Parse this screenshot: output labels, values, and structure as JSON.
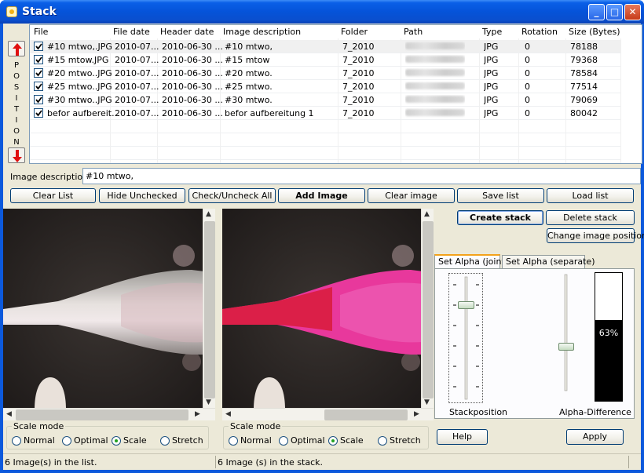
{
  "window": {
    "title": "Stack",
    "minimize_label": "_",
    "maximize_label": "□",
    "close_label": "✕"
  },
  "position_letters": [
    "P",
    "O",
    "S",
    "I",
    "T",
    "I",
    "O",
    "N"
  ],
  "list": {
    "columns": [
      "File",
      "File date",
      "Header date",
      "Image description",
      "Folder",
      "Path",
      "Type",
      "Rotation",
      "Size (Bytes)"
    ],
    "rows": [
      {
        "file": "#10 mtwo,.JPG",
        "file_date": "2010-07...",
        "header_date": "2010-06-30 ...",
        "description": "#10 mtwo,",
        "folder": "7_2010",
        "type": "JPG",
        "rotation": "0",
        "size": "78188",
        "checked": true
      },
      {
        "file": "#15 mtow.JPG",
        "file_date": "2010-07...",
        "header_date": "2010-06-30 ...",
        "description": "#15 mtow",
        "folder": "7_2010",
        "type": "JPG",
        "rotation": "0",
        "size": "79368",
        "checked": true
      },
      {
        "file": "#20 mtwo..JPG",
        "file_date": "2010-07...",
        "header_date": "2010-06-30 ...",
        "description": "#20 mtwo.",
        "folder": "7_2010",
        "type": "JPG",
        "rotation": "0",
        "size": "78584",
        "checked": true
      },
      {
        "file": "#25 mtwo..JPG",
        "file_date": "2010-07...",
        "header_date": "2010-06-30 ...",
        "description": "#25 mtwo.",
        "folder": "7_2010",
        "type": "JPG",
        "rotation": "0",
        "size": "77514",
        "checked": true
      },
      {
        "file": "#30 mtwo..JPG",
        "file_date": "2010-07...",
        "header_date": "2010-06-30 ...",
        "description": "#30 mtwo.",
        "folder": "7_2010",
        "type": "JPG",
        "rotation": "0",
        "size": "79069",
        "checked": true
      },
      {
        "file": "befor aufbereit...",
        "file_date": "2010-07...",
        "header_date": "2010-06-30 ...",
        "description": "befor aufbereitung 1",
        "folder": "7_2010",
        "type": "JPG",
        "rotation": "0",
        "size": "80042",
        "checked": true
      }
    ]
  },
  "description": {
    "label": "Image description",
    "value": "#10 mtwo,"
  },
  "buttons": {
    "clear_list": "Clear List",
    "hide_unchecked": "Hide Unchecked",
    "check_uncheck_all": "Check/Uncheck All",
    "add_image": "Add Image",
    "clear_image": "Clear image",
    "save_list": "Save list",
    "load_list": "Load list",
    "create_stack": "Create stack",
    "delete_stack": "Delete stack",
    "change_image_position": "Change image position",
    "help": "Help",
    "apply": "Apply"
  },
  "scale_mode_left": {
    "label": "Scale mode",
    "options": [
      "Normal",
      "Optimal",
      "Scale",
      "Stretch"
    ],
    "selected": "Scale"
  },
  "scale_mode_right": {
    "label": "Scale mode",
    "options": [
      "Normal",
      "Optimal",
      "Scale",
      "Stretch"
    ],
    "selected": "Scale"
  },
  "tabs": {
    "joint": "Set Alpha (joint)",
    "separate": "Set Alpha (separate)",
    "active": "joint"
  },
  "sliders": {
    "stack_position_label": "Stackposition",
    "alpha_difference_label": "Alpha-Difference",
    "alpha_percent_text": "63%",
    "alpha_fill_fraction": 0.63
  },
  "status": {
    "list_count": "6 Image(s) in the list.",
    "stack_count": "6 Image (s) in the stack."
  },
  "colors": {
    "title_bar": "#0553d9",
    "overlay_pink": "#e8389c",
    "overlay_red": "#d81b3a",
    "arrow_red": "#e01010"
  }
}
